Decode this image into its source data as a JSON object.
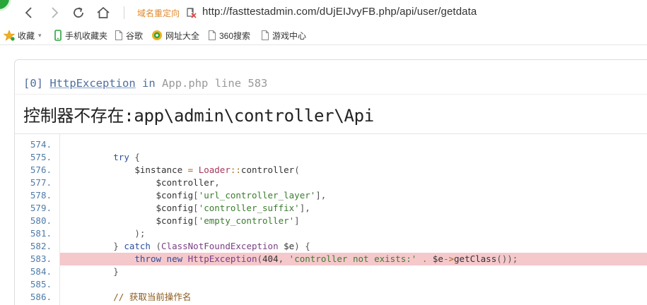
{
  "browser": {
    "dns_label": "域名重定向",
    "address": "http://fasttestadmin.com/dUjEIJvyFB.php/api/user/getdata",
    "icons": [
      "back-icon",
      "forward-icon",
      "reload-icon",
      "home-icon",
      "dns-icon"
    ]
  },
  "bookmarks": [
    {
      "label": "收藏",
      "icon": "star-icon"
    },
    {
      "label": "手机收藏夹",
      "icon": "phone-icon"
    },
    {
      "label": "谷歌",
      "icon": "page-icon"
    },
    {
      "label": "网址大全",
      "icon": "globe-icon"
    },
    {
      "label": "360搜索",
      "icon": "page-icon"
    },
    {
      "label": "游戏中心",
      "icon": "page-icon"
    }
  ],
  "exception": {
    "index": "[0]",
    "class_name": "HttpException",
    "in_word": "in",
    "file": "App.php",
    "line_word": "line",
    "line_no": "583",
    "message": "控制器不存在:app\\admin\\controller\\Api"
  },
  "source": {
    "highlight_line": "583.",
    "lines": [
      {
        "no": "574.",
        "tokens": []
      },
      {
        "no": "575.",
        "tokens": [
          [
            "pun",
            "        "
          ],
          [
            "kw",
            "try"
          ],
          [
            "pun",
            " {"
          ]
        ]
      },
      {
        "no": "576.",
        "tokens": [
          [
            "pun",
            "            "
          ],
          [
            "var",
            "$instance"
          ],
          [
            "pun",
            " "
          ],
          [
            "op",
            "="
          ],
          [
            "pun",
            " "
          ],
          [
            "fn",
            "Loader"
          ],
          [
            "op",
            "::"
          ],
          [
            "var",
            "controller"
          ],
          [
            "pun",
            "("
          ]
        ]
      },
      {
        "no": "577.",
        "tokens": [
          [
            "pun",
            "                "
          ],
          [
            "var",
            "$controller"
          ],
          [
            "pun",
            ","
          ]
        ]
      },
      {
        "no": "578.",
        "tokens": [
          [
            "pun",
            "                "
          ],
          [
            "var",
            "$config"
          ],
          [
            "pun",
            "["
          ],
          [
            "str",
            "'url_controller_layer'"
          ],
          [
            "pun",
            "],"
          ]
        ]
      },
      {
        "no": "579.",
        "tokens": [
          [
            "pun",
            "                "
          ],
          [
            "var",
            "$config"
          ],
          [
            "pun",
            "["
          ],
          [
            "str",
            "'controller_suffix'"
          ],
          [
            "pun",
            "],"
          ]
        ]
      },
      {
        "no": "580.",
        "tokens": [
          [
            "pun",
            "                "
          ],
          [
            "var",
            "$config"
          ],
          [
            "pun",
            "["
          ],
          [
            "str",
            "'empty_controller'"
          ],
          [
            "pun",
            "]"
          ]
        ]
      },
      {
        "no": "581.",
        "tokens": [
          [
            "pun",
            "            );"
          ]
        ]
      },
      {
        "no": "582.",
        "tokens": [
          [
            "pun",
            "        } "
          ],
          [
            "kw",
            "catch"
          ],
          [
            "pun",
            " ("
          ],
          [
            "cls2",
            "ClassNotFoundException"
          ],
          [
            "pun",
            " "
          ],
          [
            "var",
            "$e"
          ],
          [
            "pun",
            ") {"
          ]
        ]
      },
      {
        "no": "583.",
        "tokens": [
          [
            "pun",
            "            "
          ],
          [
            "kw",
            "throw"
          ],
          [
            "pun",
            " "
          ],
          [
            "kw",
            "new"
          ],
          [
            "pun",
            " "
          ],
          [
            "cls2",
            "HttpException"
          ],
          [
            "pun",
            "("
          ],
          [
            "var",
            "404"
          ],
          [
            "pun",
            ", "
          ],
          [
            "str",
            "'controller not exists:'"
          ],
          [
            "pun",
            " "
          ],
          [
            "op",
            "."
          ],
          [
            "pun",
            " "
          ],
          [
            "var",
            "$e"
          ],
          [
            "op",
            "->"
          ],
          [
            "var",
            "getClass"
          ],
          [
            "pun",
            "());"
          ]
        ]
      },
      {
        "no": "584.",
        "tokens": [
          [
            "pun",
            "        }"
          ]
        ]
      },
      {
        "no": "585.",
        "tokens": []
      },
      {
        "no": "586.",
        "tokens": [
          [
            "pun",
            "        "
          ],
          [
            "cmt",
            "// 获取当前操作名"
          ]
        ]
      }
    ]
  }
}
